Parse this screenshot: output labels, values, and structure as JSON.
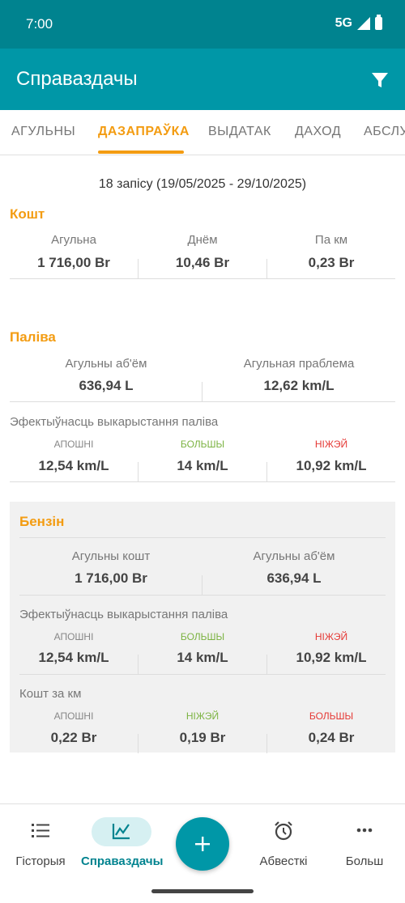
{
  "status": {
    "time": "7:00",
    "network": "5G"
  },
  "app_bar": {
    "title": "Справаздачы"
  },
  "tabs": [
    {
      "label": "АГУЛЬНЫ"
    },
    {
      "label": "ДАЗАПРАЎКА",
      "active": true
    },
    {
      "label": "ВЫДАТАК"
    },
    {
      "label": "ДАХОД"
    },
    {
      "label": "АБСЛУ"
    }
  ],
  "summary": "18 запісу (19/05/2025 - 29/10/2025)",
  "cost": {
    "title": "Кошт",
    "items": [
      {
        "label": "Агульна",
        "value": "1 716,00 Br"
      },
      {
        "label": "Днём",
        "value": "10,46 Br"
      },
      {
        "label": "Па км",
        "value": "0,23 Br"
      }
    ]
  },
  "fuel": {
    "title": "Паліва",
    "total_volume_label": "Агульны аб'ём",
    "total_volume": "636,94 L",
    "total_problem_label": "Агульная праблема",
    "total_problem": "12,62 km/L",
    "efficiency_title": "Эфектыўнасць выкарыстання паліва",
    "efficiency": [
      {
        "label": "АПОШНІ",
        "value": "12,54 km/L"
      },
      {
        "label": "БОЛЬШЫ",
        "value": "14 km/L"
      },
      {
        "label": "НІЖЭЙ",
        "value": "10,92 km/L"
      }
    ]
  },
  "petrol": {
    "title": "Бензін",
    "total_cost_label": "Агульны кошт",
    "total_cost": "1 716,00 Br",
    "total_volume_label": "Агульны аб'ём",
    "total_volume": "636,94 L",
    "efficiency_title": "Эфектыўнасць выкарыстання паліва",
    "efficiency": [
      {
        "label": "АПОШНІ",
        "value": "12,54 km/L"
      },
      {
        "label": "БОЛЬШЫ",
        "value": "14 km/L"
      },
      {
        "label": "НІЖЭЙ",
        "value": "10,92 km/L"
      }
    ],
    "cost_per_km_title": "Кошт за км",
    "cost_per_km": [
      {
        "label": "АПОШНІ",
        "value": "0,22 Br"
      },
      {
        "label": "НІЖЭЙ",
        "value": "0,19 Br"
      },
      {
        "label": "БОЛЬШЫ",
        "value": "0,24 Br"
      }
    ]
  },
  "bottom_nav": [
    {
      "label": "Гісторыя",
      "icon": "list-icon"
    },
    {
      "label": "Справаздачы",
      "icon": "chart-icon",
      "active": true
    },
    {
      "label": "Абвесткі",
      "icon": "alarm-clock-icon"
    },
    {
      "label": "Больш",
      "icon": "more-dots-icon"
    }
  ],
  "colors": {
    "primary": "#0097a7",
    "primary_dark": "#00838f",
    "accent": "#f39c12",
    "green": "#7cb342",
    "red": "#e53935"
  }
}
